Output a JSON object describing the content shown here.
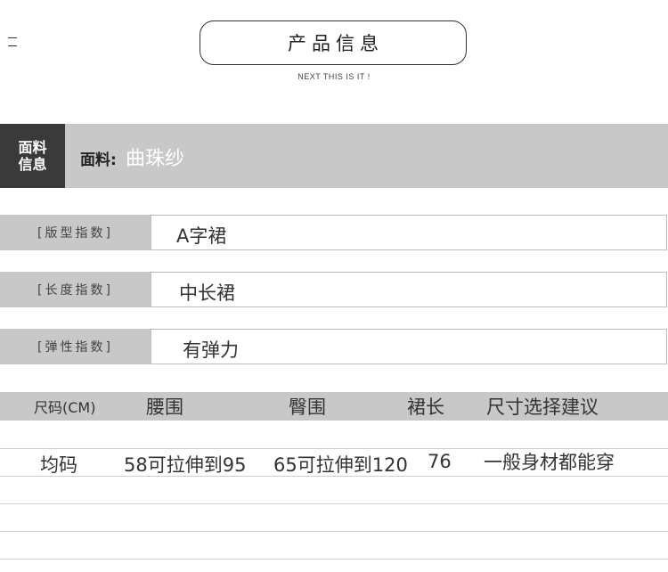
{
  "header": {
    "title": "产品信息",
    "subtitle": "NEXT THIS IS IT !"
  },
  "fabric": {
    "tag_line1": "面料",
    "tag_line2": "信息",
    "label": "面料:",
    "value": "曲珠纱"
  },
  "specs": [
    {
      "label": "[版型指数]",
      "value": "A字裙"
    },
    {
      "label": "[长度指数]",
      "value": "中长裙"
    },
    {
      "label": "[弹性指数]",
      "value": "有弹力"
    }
  ],
  "size_table": {
    "headers": [
      "尺码(CM)",
      "腰围",
      "臀围",
      "裙长",
      "尺寸选择建议"
    ],
    "rows": [
      [
        "均码",
        "58可拉伸到95",
        "65可拉伸到120",
        "76",
        "一般身材都能穿"
      ]
    ]
  },
  "colors": {
    "band_gray": "#c8c8c8",
    "tag_dark": "#3a3a3a",
    "text": "#333333"
  }
}
